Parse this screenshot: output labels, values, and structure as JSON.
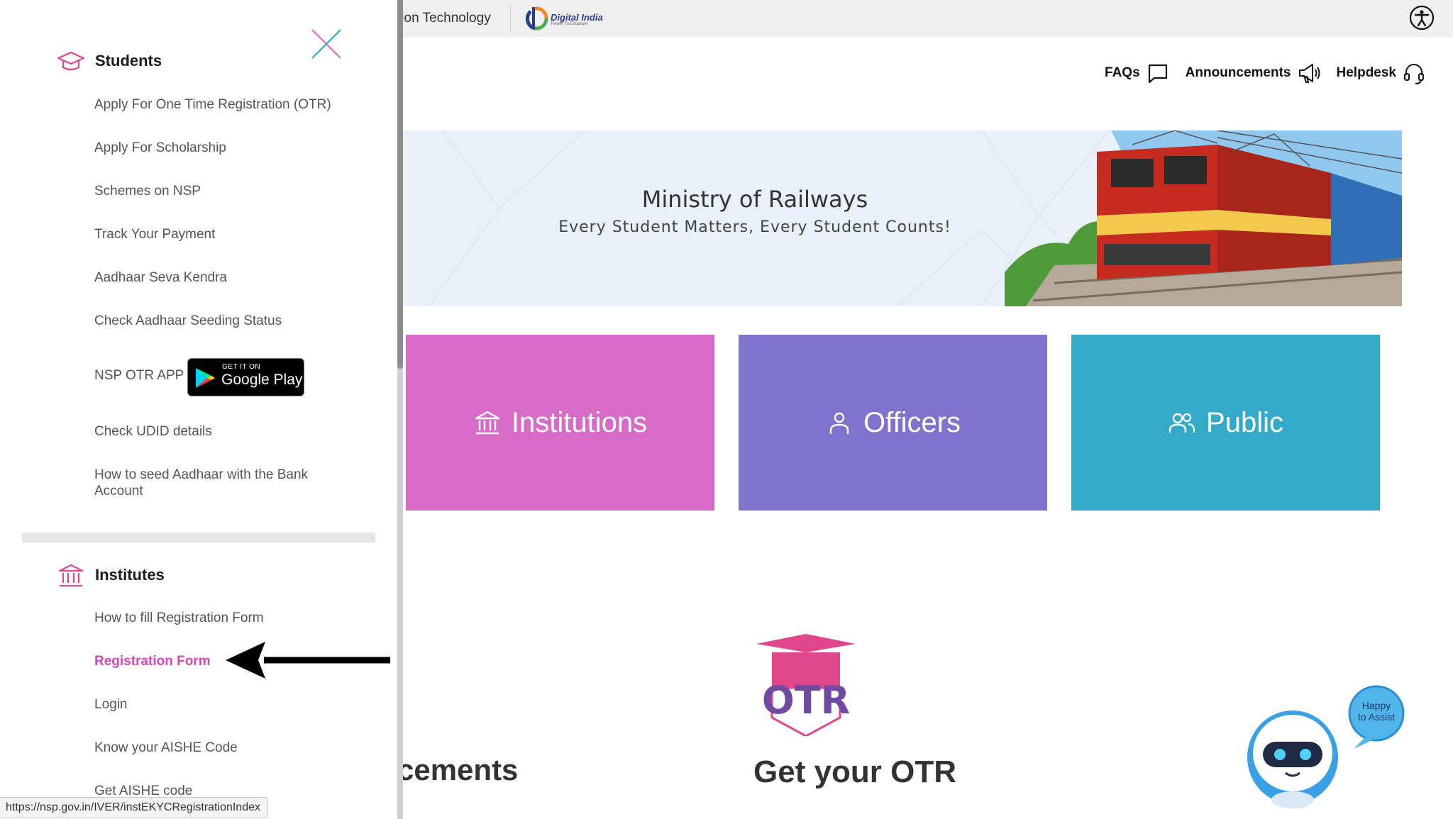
{
  "topbar": {
    "ministry_text": "tion Technology",
    "digital_india_title": "Digital India",
    "digital_india_tagline": "Power To Empower"
  },
  "header_links": [
    {
      "label": "FAQs",
      "icon": "chat-icon"
    },
    {
      "label": "Announcements",
      "icon": "megaphone-icon"
    },
    {
      "label": "Helpdesk",
      "icon": "headset-icon"
    }
  ],
  "banner": {
    "title": "Ministry of Railways",
    "subtitle": "Every Student Matters, Every Student Counts!"
  },
  "tiles": [
    {
      "label": "Institutions",
      "icon": "bank-icon",
      "color": "#d86bc8"
    },
    {
      "label": "Officers",
      "icon": "person-icon",
      "color": "#7f73ce"
    },
    {
      "label": "Public",
      "icon": "people-icon",
      "color": "#34a9c8"
    }
  ],
  "lower": {
    "announcements_partial": "cements",
    "otr_title": "Get your OTR",
    "otr_logo_text": "OTR",
    "bot_bubble": "Happy to Assist"
  },
  "drawer": {
    "students": {
      "heading": "Students",
      "items": [
        "Apply For One Time Registration (OTR)",
        "Apply For Scholarship",
        "Schemes on NSP",
        "Track Your Payment",
        "Aadhaar Seva Kendra",
        "Check Aadhaar Seeding Status",
        "NSP OTR APP",
        "Check UDID details",
        "How to seed Aadhaar with the Bank Account"
      ],
      "google_play": {
        "small": "GET IT ON",
        "store": "Google Play"
      }
    },
    "institutes": {
      "heading": "Institutes",
      "items": [
        "How to fill Registration Form",
        "Registration Form",
        "Login",
        "Know your AISHE Code",
        "Get AISHE code"
      ],
      "active_item": "Registration Form"
    }
  },
  "status_url": "https://nsp.gov.in/IVER/instEKYCRegistrationIndex",
  "colors": {
    "accent_pink": "#d34ab3",
    "institutions": "#d86bc8",
    "officers": "#7f73ce",
    "public": "#34a9c8"
  }
}
